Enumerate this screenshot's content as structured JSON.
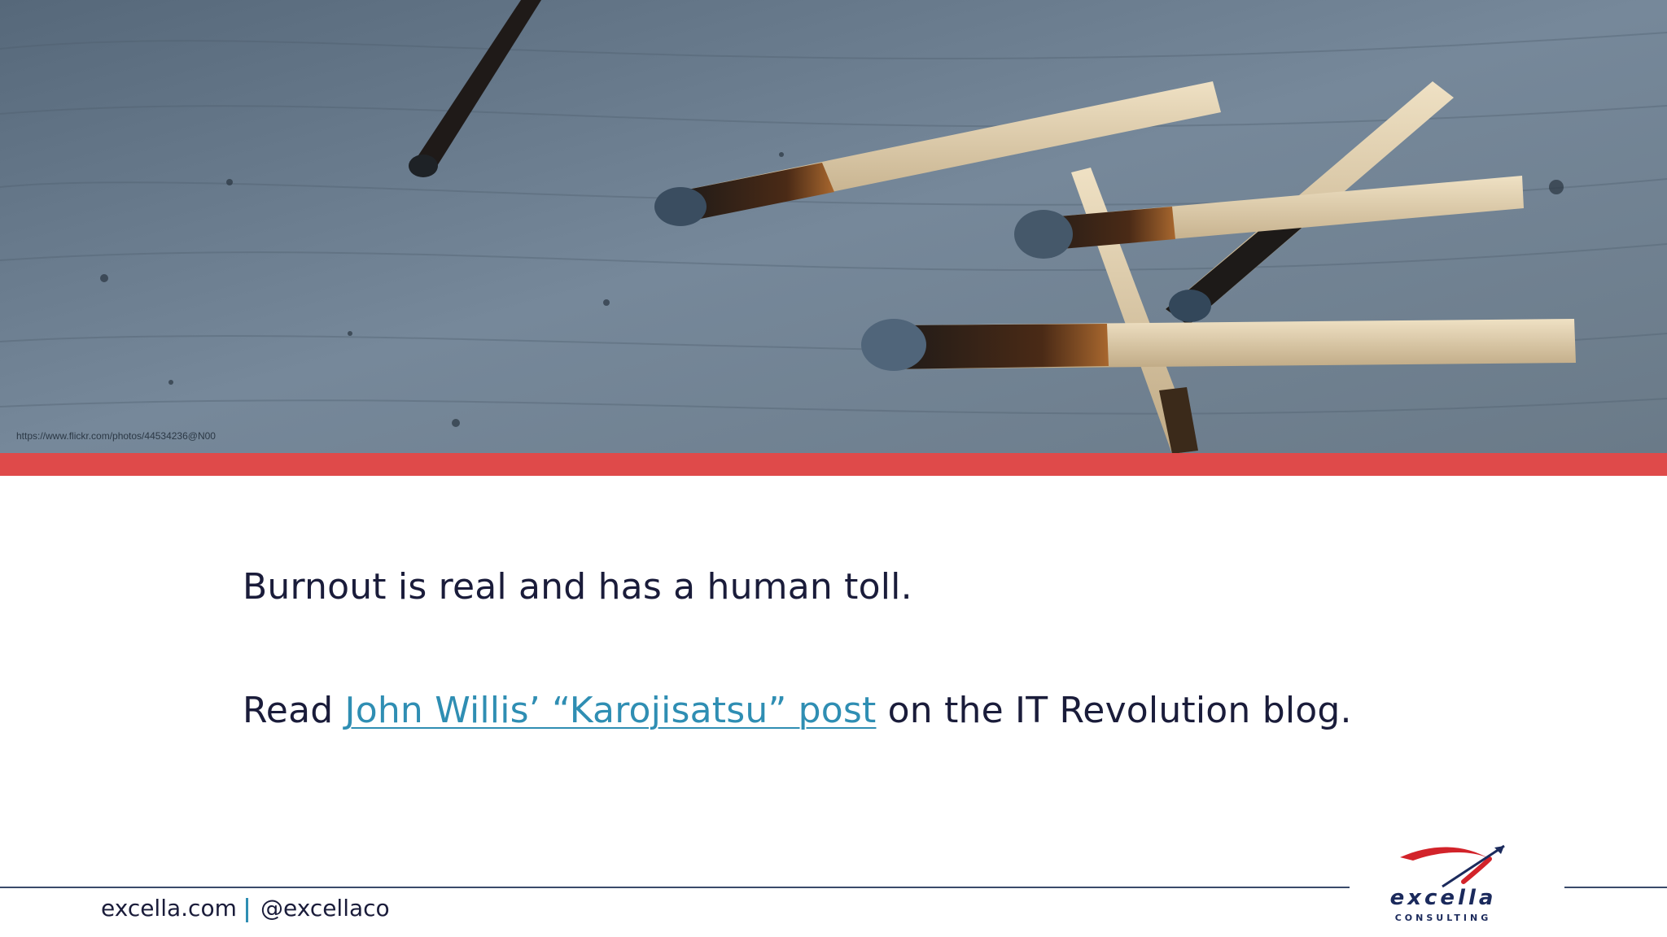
{
  "photo": {
    "credit": "https://www.flickr.com/photos/44534236@N00"
  },
  "body": {
    "line1": "Burnout is real and has a human toll.",
    "line2_prefix": "Read ",
    "line2_link": "John Willis’ “Karojisatsu” post",
    "line2_suffix": " on the IT Revolution blog."
  },
  "footer": {
    "site": "excella.com",
    "handle": "@excellaco"
  },
  "logo": {
    "name": "excella",
    "tagline": "CONSULTING"
  },
  "colors": {
    "accent_bar": "#df4a4a",
    "link": "#2f8eb3",
    "text": "#1a1c3a",
    "logo_red": "#d2232a",
    "logo_navy": "#1b2a5c"
  },
  "icons": [
    "burnt-matches-photo",
    "excella-swoosh-logo"
  ]
}
